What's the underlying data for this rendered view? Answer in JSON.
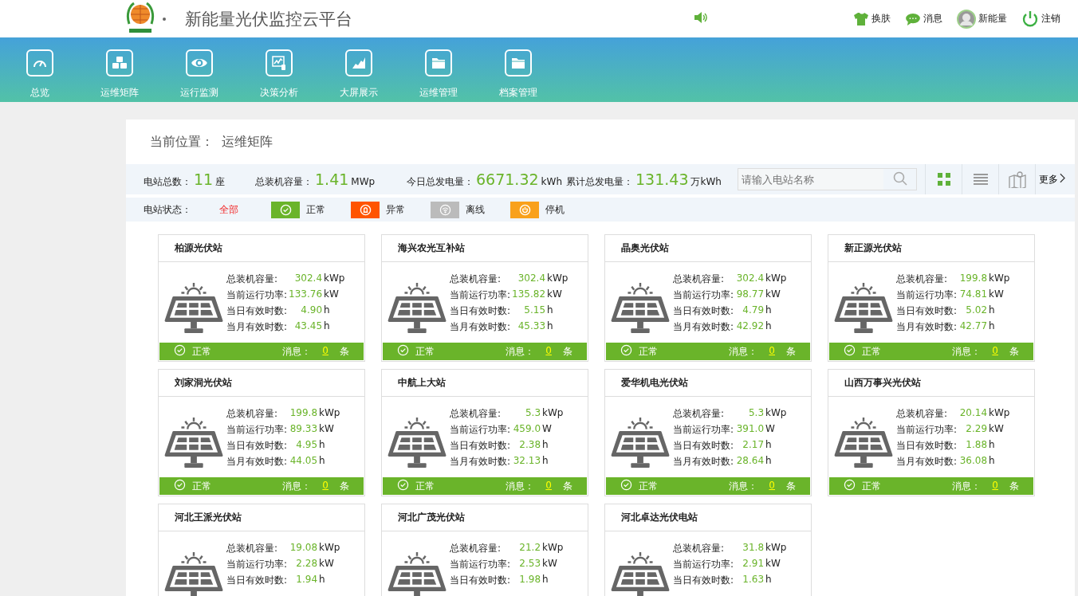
{
  "header": {
    "title": "新能量光伏监控云平台",
    "actions": [
      {
        "kind": "skin",
        "label": "换肤"
      },
      {
        "kind": "message",
        "label": "消息"
      },
      {
        "kind": "user",
        "label": "新能量"
      },
      {
        "kind": "logout",
        "label": "注销"
      }
    ]
  },
  "nav": [
    {
      "kind": "gauge",
      "label": "总览"
    },
    {
      "kind": "cubes",
      "label": "运维矩阵"
    },
    {
      "kind": "eye",
      "label": "运行监测"
    },
    {
      "kind": "analysis",
      "label": "决策分析"
    },
    {
      "kind": "area",
      "label": "大屏展示"
    },
    {
      "kind": "folder",
      "label": "运维管理"
    },
    {
      "kind": "folder",
      "label": "档案管理"
    }
  ],
  "breadcrumb": {
    "label": "当前位置：",
    "current": "运维矩阵"
  },
  "stats": [
    {
      "label": "电站总数：",
      "value": "11",
      "unit": "座"
    },
    {
      "label": "总装机容量：",
      "value": "1.41",
      "unit": "MWp"
    },
    {
      "label": "今日总发电量：",
      "value": "6671.32",
      "unit": "kWh"
    },
    {
      "label": "累计总发电量：",
      "value": "131.43",
      "unit": "万kWh"
    }
  ],
  "search": {
    "placeholder": "请输入电站名称"
  },
  "views": [
    {
      "kind": "grid",
      "selected": true
    },
    {
      "kind": "list",
      "selected": false
    },
    {
      "kind": "map",
      "selected": false
    }
  ],
  "more": "更多",
  "filter": {
    "label": "电站状态：",
    "options": [
      {
        "kind": "all",
        "label": "全部",
        "selected": true
      },
      {
        "kind": "normal",
        "label": "正常",
        "color": "#6ab42a",
        "selected": false
      },
      {
        "kind": "fault",
        "label": "异常",
        "color": "#ff5500",
        "selected": false
      },
      {
        "kind": "offline",
        "label": "离线",
        "color": "#bbbbbb",
        "selected": false
      },
      {
        "kind": "stopped",
        "label": "停机",
        "color": "#f9a11b",
        "selected": false
      }
    ]
  },
  "stations": [
    {
      "name": "柏源光伏站",
      "metrics": [
        {
          "label": "总装机容量:",
          "value": "302.4",
          "unit": "kWp"
        },
        {
          "label": "当前运行功率:",
          "value": "133.76",
          "unit": "kW"
        },
        {
          "label": "当日有效时数:",
          "value": "4.90",
          "unit": "h"
        },
        {
          "label": "当月有效时数:",
          "value": "43.45",
          "unit": "h"
        }
      ],
      "status": {
        "kind": "normal",
        "label": "正常"
      },
      "messages": {
        "label": "消息：",
        "count": "0",
        "unit": "条"
      }
    },
    {
      "name": "海兴农光互补站",
      "metrics": [
        {
          "label": "总装机容量:",
          "value": "302.4",
          "unit": "kWp"
        },
        {
          "label": "当前运行功率:",
          "value": "135.82",
          "unit": "kW"
        },
        {
          "label": "当日有效时数:",
          "value": "5.15",
          "unit": "h"
        },
        {
          "label": "当月有效时数:",
          "value": "45.33",
          "unit": "h"
        }
      ],
      "status": {
        "kind": "normal",
        "label": "正常"
      },
      "messages": {
        "label": "消息：",
        "count": "0",
        "unit": "条"
      }
    },
    {
      "name": "晶奥光伏站",
      "metrics": [
        {
          "label": "总装机容量:",
          "value": "302.4",
          "unit": "kWp"
        },
        {
          "label": "当前运行功率:",
          "value": "98.77",
          "unit": "kW"
        },
        {
          "label": "当日有效时数:",
          "value": "4.79",
          "unit": "h"
        },
        {
          "label": "当月有效时数:",
          "value": "42.92",
          "unit": "h"
        }
      ],
      "status": {
        "kind": "normal",
        "label": "正常"
      },
      "messages": {
        "label": "消息：",
        "count": "0",
        "unit": "条"
      }
    },
    {
      "name": "新正源光伏站",
      "metrics": [
        {
          "label": "总装机容量:",
          "value": "199.8",
          "unit": "kWp"
        },
        {
          "label": "当前运行功率:",
          "value": "74.81",
          "unit": "kW"
        },
        {
          "label": "当日有效时数:",
          "value": "5.02",
          "unit": "h"
        },
        {
          "label": "当月有效时数:",
          "value": "42.77",
          "unit": "h"
        }
      ],
      "status": {
        "kind": "normal",
        "label": "正常"
      },
      "messages": {
        "label": "消息：",
        "count": "0",
        "unit": "条"
      }
    },
    {
      "name": "刘家洞光伏站",
      "metrics": [
        {
          "label": "总装机容量:",
          "value": "199.8",
          "unit": "kWp"
        },
        {
          "label": "当前运行功率:",
          "value": "89.33",
          "unit": "kW"
        },
        {
          "label": "当日有效时数:",
          "value": "4.95",
          "unit": "h"
        },
        {
          "label": "当月有效时数:",
          "value": "44.05",
          "unit": "h"
        }
      ],
      "status": {
        "kind": "normal",
        "label": "正常"
      },
      "messages": {
        "label": "消息：",
        "count": "0",
        "unit": "条"
      }
    },
    {
      "name": "中航上大站",
      "metrics": [
        {
          "label": "总装机容量:",
          "value": "5.3",
          "unit": "kWp"
        },
        {
          "label": "当前运行功率:",
          "value": "459.0",
          "unit": "W"
        },
        {
          "label": "当日有效时数:",
          "value": "2.38",
          "unit": "h"
        },
        {
          "label": "当月有效时数:",
          "value": "32.13",
          "unit": "h"
        }
      ],
      "status": {
        "kind": "normal",
        "label": "正常"
      },
      "messages": {
        "label": "消息：",
        "count": "0",
        "unit": "条"
      }
    },
    {
      "name": "爱华机电光伏站",
      "metrics": [
        {
          "label": "总装机容量:",
          "value": "5.3",
          "unit": "kWp"
        },
        {
          "label": "当前运行功率:",
          "value": "391.0",
          "unit": "W"
        },
        {
          "label": "当日有效时数:",
          "value": "2.17",
          "unit": "h"
        },
        {
          "label": "当月有效时数:",
          "value": "28.64",
          "unit": "h"
        }
      ],
      "status": {
        "kind": "normal",
        "label": "正常"
      },
      "messages": {
        "label": "消息：",
        "count": "0",
        "unit": "条"
      }
    },
    {
      "name": "山西万事兴光伏站",
      "metrics": [
        {
          "label": "总装机容量:",
          "value": "20.14",
          "unit": "kWp"
        },
        {
          "label": "当前运行功率:",
          "value": "2.29",
          "unit": "kW"
        },
        {
          "label": "当日有效时数:",
          "value": "1.88",
          "unit": "h"
        },
        {
          "label": "当月有效时数:",
          "value": "36.08",
          "unit": "h"
        }
      ],
      "status": {
        "kind": "normal",
        "label": "正常"
      },
      "messages": {
        "label": "消息：",
        "count": "0",
        "unit": "条"
      }
    },
    {
      "name": "河北王派光伏站",
      "metrics": [
        {
          "label": "总装机容量:",
          "value": "19.08",
          "unit": "kWp"
        },
        {
          "label": "当前运行功率:",
          "value": "2.28",
          "unit": "kW"
        },
        {
          "label": "当日有效时数:",
          "value": "1.94",
          "unit": "h"
        }
      ]
    },
    {
      "name": "河北广茂光伏站",
      "metrics": [
        {
          "label": "总装机容量:",
          "value": "21.2",
          "unit": "kWp"
        },
        {
          "label": "当前运行功率:",
          "value": "2.53",
          "unit": "kW"
        },
        {
          "label": "当日有效时数:",
          "value": "1.98",
          "unit": "h"
        }
      ]
    },
    {
      "name": "河北卓达光伏电站",
      "metrics": [
        {
          "label": "总装机容量:",
          "value": "31.8",
          "unit": "kWp"
        },
        {
          "label": "当前运行功率:",
          "value": "2.91",
          "unit": "kW"
        },
        {
          "label": "当日有效时数:",
          "value": "1.63",
          "unit": "h"
        }
      ]
    }
  ]
}
